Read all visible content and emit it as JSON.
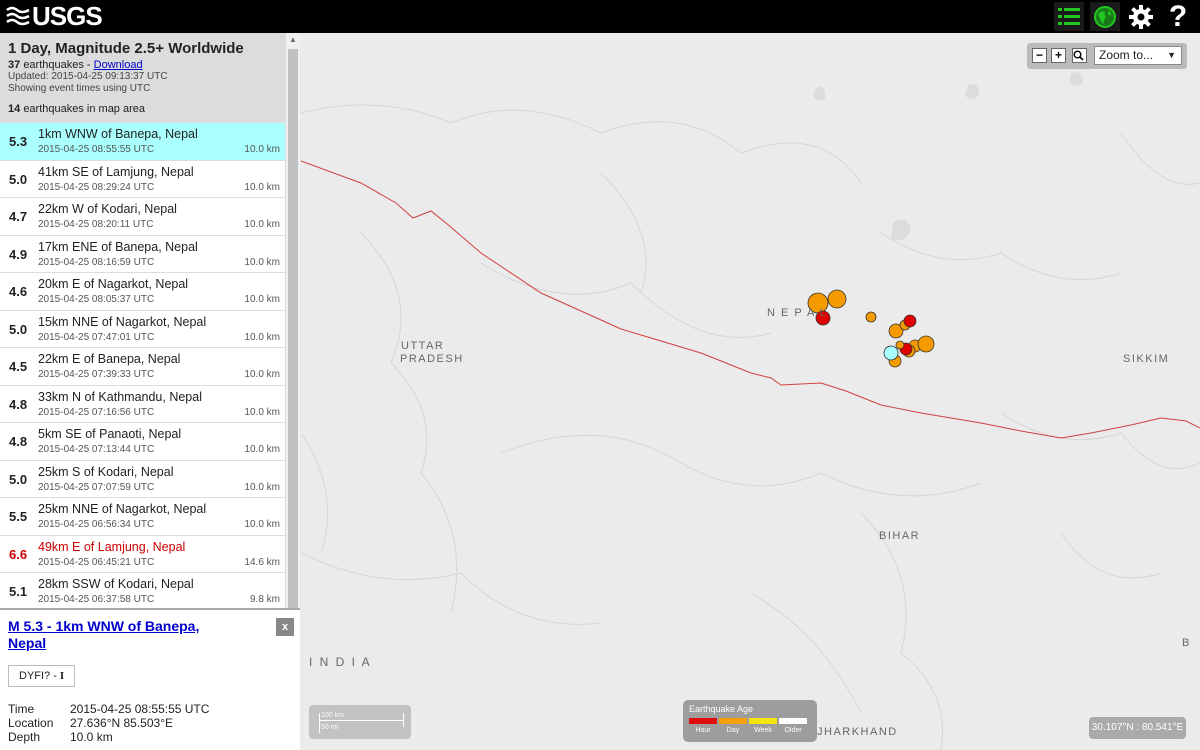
{
  "brand": {
    "logo_text": "USGS"
  },
  "list": {
    "title": "1 Day, Magnitude 2.5+ Worldwide",
    "count": "37",
    "count_suffix": "earthquakes -",
    "download_label": "Download",
    "updated": "Updated: 2015-04-25 09:13:37 UTC",
    "time_note": "Showing event times using UTC",
    "map_area_count": "14",
    "map_area_suffix": "earthquakes in map area"
  },
  "earthquakes": [
    {
      "mag": "5.3",
      "place": "1km WNW of Banepa, Nepal",
      "time": "2015-04-25 08:55:55 UTC",
      "depth": "10.0 km"
    },
    {
      "mag": "5.0",
      "place": "41km SE of Lamjung, Nepal",
      "time": "2015-04-25 08:29:24 UTC",
      "depth": "10.0 km"
    },
    {
      "mag": "4.7",
      "place": "22km W of Kodari, Nepal",
      "time": "2015-04-25 08:20:11 UTC",
      "depth": "10.0 km"
    },
    {
      "mag": "4.9",
      "place": "17km ENE of Banepa, Nepal",
      "time": "2015-04-25 08:16:59 UTC",
      "depth": "10.0 km"
    },
    {
      "mag": "4.6",
      "place": "20km E of Nagarkot, Nepal",
      "time": "2015-04-25 08:05:37 UTC",
      "depth": "10.0 km"
    },
    {
      "mag": "5.0",
      "place": "15km NNE of Nagarkot, Nepal",
      "time": "2015-04-25 07:47:01 UTC",
      "depth": "10.0 km"
    },
    {
      "mag": "4.5",
      "place": "22km E of Banepa, Nepal",
      "time": "2015-04-25 07:39:33 UTC",
      "depth": "10.0 km"
    },
    {
      "mag": "4.8",
      "place": "33km N of Kathmandu, Nepal",
      "time": "2015-04-25 07:16:56 UTC",
      "depth": "10.0 km"
    },
    {
      "mag": "4.8",
      "place": "5km SE of Panaoti, Nepal",
      "time": "2015-04-25 07:13:44 UTC",
      "depth": "10.0 km"
    },
    {
      "mag": "5.0",
      "place": "25km S of Kodari, Nepal",
      "time": "2015-04-25 07:07:59 UTC",
      "depth": "10.0 km"
    },
    {
      "mag": "5.5",
      "place": "25km NNE of Nagarkot, Nepal",
      "time": "2015-04-25 06:56:34 UTC",
      "depth": "10.0 km"
    },
    {
      "mag": "6.6",
      "place": "49km E of Lamjung, Nepal",
      "time": "2015-04-25 06:45:21 UTC",
      "depth": "14.6 km"
    },
    {
      "mag": "5.1",
      "place": "28km SSW of Kodari, Nepal",
      "time": "2015-04-25 06:37:58 UTC",
      "depth": "9.8 km"
    }
  ],
  "detail": {
    "title": "M 5.3 - 1km WNW of Banepa, Nepal",
    "close_label": "x",
    "dyfi_label": "DYFI? -",
    "dyfi_value": "I",
    "time_label": "Time",
    "time_value": "2015-04-25 08:55:55 UTC",
    "location_label": "Location",
    "location_value": "27.636°N 85.503°E",
    "depth_label": "Depth",
    "depth_value": "10.0 km"
  },
  "map": {
    "zoom_in": "+",
    "zoom_out": "−",
    "zoom_to_label": "Zoom to...",
    "labels": {
      "nepal": "N E P A L",
      "uttar_pradesh_1": "UTTAR",
      "uttar_pradesh_2": "PRADESH",
      "sikkim": "SIKKIM",
      "bihar": "BIHAR",
      "india": "I N D I A",
      "jharkhand": "JHARKHAND",
      "edge_b": "B"
    },
    "scale_km": "100 km",
    "scale_mi": "50 mi",
    "legend_title": "Earthquake Age",
    "legend": [
      {
        "label": "Hour",
        "color": "#e00000"
      },
      {
        "label": "Day",
        "color": "#f59b00"
      },
      {
        "label": "Week",
        "color": "#f5e600"
      },
      {
        "label": "Older",
        "color": "#ffffff"
      }
    ],
    "coords": "30.107°N : 80.541°E"
  },
  "colors": {
    "hour": "#e00000",
    "day": "#f59b00",
    "selected": "#aaffff",
    "border": "#d04040"
  }
}
